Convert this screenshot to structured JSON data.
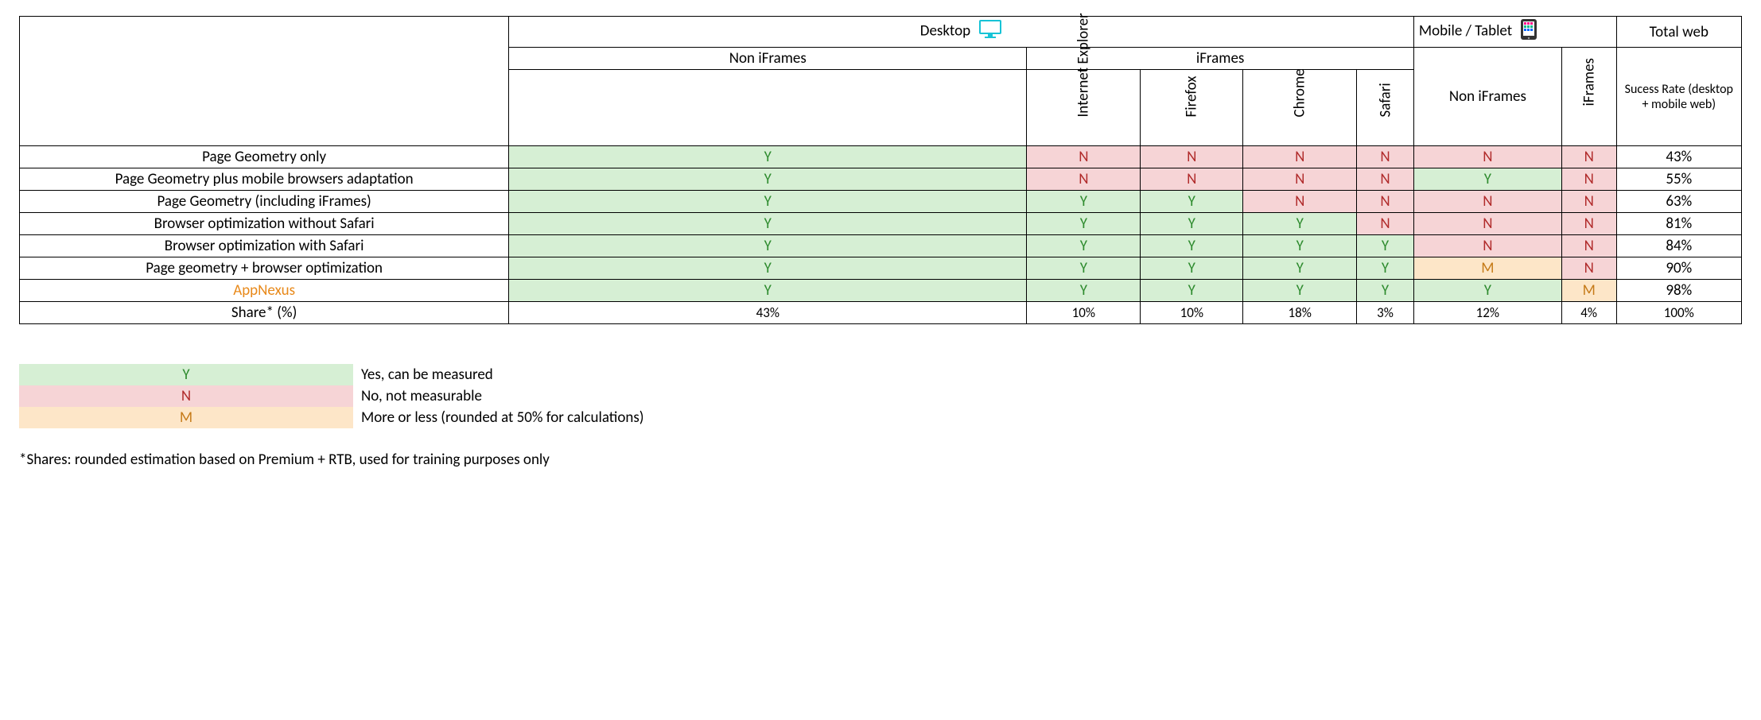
{
  "headers": {
    "desktop": "Desktop",
    "mobile": "Mobile / Tablet",
    "total_web": "Total web",
    "non_iframes": "Non iFrames",
    "iframes": "iFrames",
    "success_rate": "Sucess Rate (desktop + mobile web)",
    "browsers": {
      "ie": "Internet Explorer",
      "ff": "Firefox",
      "ch": "Chrome",
      "sf": "Safari"
    }
  },
  "rows": [
    {
      "label": "Page Geometry only",
      "cells": [
        "Y",
        "N",
        "N",
        "N",
        "N",
        "N",
        "N"
      ],
      "rate": "43%"
    },
    {
      "label": "Page Geometry plus mobile browsers adaptation",
      "cells": [
        "Y",
        "N",
        "N",
        "N",
        "N",
        "Y",
        "N"
      ],
      "rate": "55%"
    },
    {
      "label": "Page Geometry (including iFrames)",
      "cells": [
        "Y",
        "Y",
        "Y",
        "N",
        "N",
        "N",
        "N"
      ],
      "rate": "63%"
    },
    {
      "label": "Browser optimization without Safari",
      "cells": [
        "Y",
        "Y",
        "Y",
        "Y",
        "N",
        "N",
        "N"
      ],
      "rate": "81%"
    },
    {
      "label": "Browser optimization with Safari",
      "cells": [
        "Y",
        "Y",
        "Y",
        "Y",
        "Y",
        "N",
        "N"
      ],
      "rate": "84%"
    },
    {
      "label": "Page geometry + browser optimization",
      "cells": [
        "Y",
        "Y",
        "Y",
        "Y",
        "Y",
        "M",
        "N"
      ],
      "rate": "90%"
    },
    {
      "label": "AppNexus",
      "appnexus": true,
      "cells": [
        "Y",
        "Y",
        "Y",
        "Y",
        "Y",
        "Y",
        "M"
      ],
      "rate": "98%"
    }
  ],
  "share": {
    "label": "Share* (%)",
    "cells": [
      "43%",
      "10%",
      "10%",
      "18%",
      "3%",
      "12%",
      "4%"
    ],
    "total": "100%"
  },
  "legend": {
    "y": {
      "sym": "Y",
      "text": "Yes, can be measured"
    },
    "n": {
      "sym": "N",
      "text": "No, not measurable"
    },
    "m": {
      "sym": "M",
      "text": "More or less (rounded at 50% for calculations)"
    }
  },
  "footnote": "*Shares: rounded estimation based on Premium + RTB, used for training purposes only",
  "chart_data": {
    "type": "table",
    "columns": [
      "Desktop Non iFrames",
      "Desktop iFrames Internet Explorer",
      "Desktop iFrames Firefox",
      "Desktop iFrames Chrome",
      "Desktop iFrames Safari",
      "Mobile/Tablet Non iFrames",
      "Mobile/Tablet iFrames",
      "Success Rate"
    ],
    "rows": [
      [
        "Page Geometry only",
        "Y",
        "N",
        "N",
        "N",
        "N",
        "N",
        "N",
        "43%"
      ],
      [
        "Page Geometry plus mobile browsers adaptation",
        "Y",
        "N",
        "N",
        "N",
        "N",
        "Y",
        "N",
        "55%"
      ],
      [
        "Page Geometry (including iFrames)",
        "Y",
        "Y",
        "Y",
        "N",
        "N",
        "N",
        "N",
        "63%"
      ],
      [
        "Browser optimization without Safari",
        "Y",
        "Y",
        "Y",
        "Y",
        "N",
        "N",
        "N",
        "81%"
      ],
      [
        "Browser optimization with Safari",
        "Y",
        "Y",
        "Y",
        "Y",
        "Y",
        "N",
        "N",
        "84%"
      ],
      [
        "Page geometry + browser optimization",
        "Y",
        "Y",
        "Y",
        "Y",
        "Y",
        "M",
        "N",
        "90%"
      ],
      [
        "AppNexus",
        "Y",
        "Y",
        "Y",
        "Y",
        "Y",
        "Y",
        "M",
        "98%"
      ]
    ],
    "share_row": [
      "Share* (%)",
      "43%",
      "10%",
      "10%",
      "18%",
      "3%",
      "12%",
      "4%",
      "100%"
    ]
  }
}
